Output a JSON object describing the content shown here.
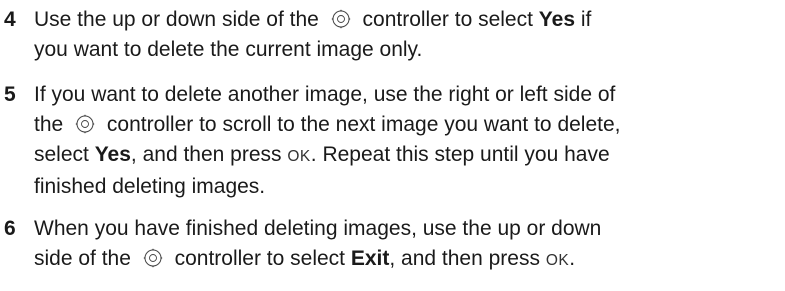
{
  "steps": [
    {
      "number": "4",
      "line1": {
        "a": "Use the up or down side of the",
        "b": "controller to select",
        "c": "Yes",
        "d": "if"
      },
      "line2": "you want to delete the current image only."
    },
    {
      "number": "5",
      "line1": "If you want to delete another image, use the right or left side of",
      "line2": {
        "a": "the",
        "b": "controller to scroll to the next image you want to delete,"
      },
      "line3": {
        "a": "select",
        "b": "Yes",
        "c": ", and then press",
        "d": "OK",
        "e": ". Repeat this step until you have"
      },
      "line4": "finished deleting images."
    },
    {
      "number": "6",
      "line1": "When you have finished deleting images, use the up or down",
      "line2": {
        "a": "side of the",
        "b": "controller to select",
        "c": "Exit",
        "d": ", and then press",
        "e": "OK",
        "f": "."
      }
    }
  ],
  "icons": {
    "controller": "controller-dial-icon"
  }
}
